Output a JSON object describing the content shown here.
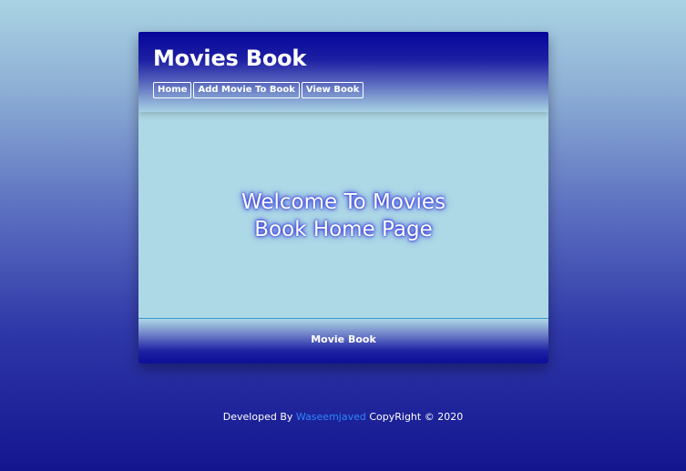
{
  "header": {
    "title": "Movies Book",
    "nav": [
      {
        "label": "Home"
      },
      {
        "label": "Add Movie To Book"
      },
      {
        "label": "View Book"
      }
    ]
  },
  "main": {
    "welcome": "Welcome To Movies Book Home Page"
  },
  "footer": {
    "text": "Movie Book"
  },
  "credit": {
    "prefix": "Developed By ",
    "author": "Waseemjaved",
    "suffix": " CopyRight © 2020"
  },
  "colors": {
    "header_top": "#06069b",
    "card_bg": "#add8e6",
    "link": "#2e86ff"
  }
}
